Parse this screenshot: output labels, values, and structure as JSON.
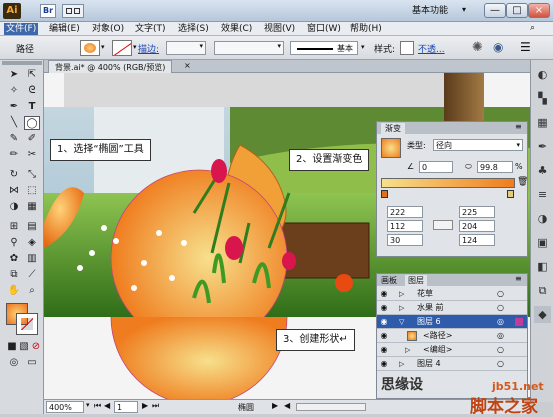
{
  "app": {
    "logo": "Ai",
    "workspace": "基本功能",
    "window_controls": [
      "—",
      "□",
      "×"
    ]
  },
  "menu": [
    "文件(F)",
    "编辑(E)",
    "对象(O)",
    "文字(T)",
    "选择(S)",
    "效果(C)",
    "视图(V)",
    "窗口(W)",
    "帮助(H)"
  ],
  "control_bar": {
    "selection_label": "路径",
    "stroke_label": "描边:",
    "stroke_profile": "基本",
    "style_label": "样式:",
    "opacity_label": "不透..."
  },
  "document": {
    "tab_title": "背景.ai* @ 400% (RGB/预览)",
    "zoom": "400%",
    "page": "1",
    "status": "椭圆"
  },
  "callouts": {
    "step1": "1、选择“椭圆”工具",
    "step2": "2、设置渐变色",
    "step3": "3、创建形状↵"
  },
  "gradient_panel": {
    "tab": "渐变",
    "type_label": "类型:",
    "type_value": "径向",
    "angle": "0",
    "aspect": "99.8",
    "location": "",
    "percent_sign": "%",
    "rgb_left": [
      "222",
      "112",
      "30"
    ],
    "rgb_right": [
      "225",
      "204",
      "124"
    ],
    "colors": {
      "start": "#f7e08c",
      "end": "#ef7c1e"
    }
  },
  "layers_panel": {
    "tabs": [
      "画板",
      "图层"
    ],
    "rows": [
      {
        "name": "花草",
        "selected": false,
        "indent": 0
      },
      {
        "name": "水果 前",
        "selected": false,
        "indent": 0
      },
      {
        "name": "图层 6",
        "selected": true,
        "indent": 0
      },
      {
        "name": "<路径>",
        "selected": false,
        "indent": 1
      },
      {
        "name": "<编组>",
        "selected": false,
        "indent": 1
      },
      {
        "name": "图层 4",
        "selected": false,
        "indent": 0
      }
    ]
  },
  "watermark": {
    "site": "jb51.net",
    "name": "脚本之家",
    "partial": "思缘设"
  }
}
